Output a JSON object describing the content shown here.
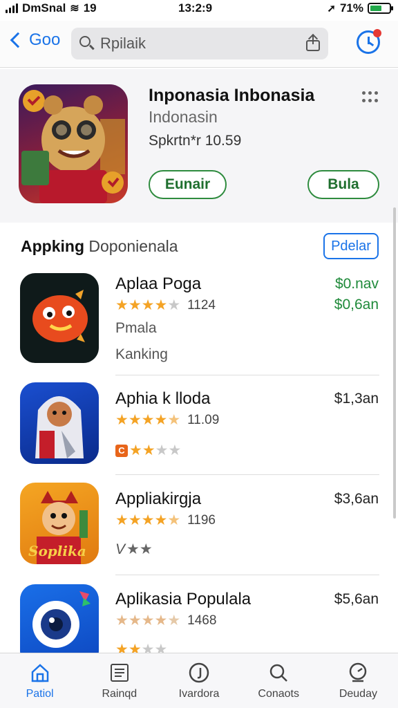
{
  "status": {
    "carrier": "DmSnal",
    "time": "13:2:9",
    "battery": "71%",
    "network": "19",
    "battery_level": 0.6
  },
  "nav": {
    "back_label": "Goo",
    "search_value": "Rpilaik"
  },
  "featured": {
    "title": "Inponasia Inbonasia",
    "subtitle": "Indonasin",
    "rating": "Spkrtn*r 10.59",
    "left_button": "Eunair",
    "right_button": "Bula"
  },
  "section": {
    "title_bold": "Appking",
    "title_rest": " Doponienala",
    "button": "Pdelar"
  },
  "apps": [
    {
      "name": "Aplaa Poga",
      "stars": 4,
      "count": "1124",
      "price": "$0.nav",
      "price2": "$0,6an",
      "line1": "Pmala",
      "line2": "Kanking"
    },
    {
      "name": "Aphia k lloda",
      "stars": 5,
      "count": "11.09",
      "price": "$1,3an",
      "sub_badge": "C",
      "sub_stars": 2
    },
    {
      "name": "Appliakirgja",
      "stars": 5,
      "count": "1196",
      "price": "$3,6an",
      "sub_prefix": "V",
      "sub_stars": 2
    },
    {
      "name": "Aplikasia Populala",
      "stars": 5,
      "count": "1468",
      "price": "$5,6an",
      "sub_stars": 2
    }
  ],
  "tabs": [
    {
      "label": "Patiol",
      "icon": "home-icon"
    },
    {
      "label": "Rainqd",
      "icon": "list-icon"
    },
    {
      "label": "Ivardora",
      "icon": "circle-j-icon"
    },
    {
      "label": "Conaots",
      "icon": "search-icon"
    },
    {
      "label": "Deuday",
      "icon": "timer-icon"
    }
  ],
  "colors": {
    "accent": "#1a73e8",
    "green": "#1f8a3a",
    "star": "#f4a325"
  }
}
